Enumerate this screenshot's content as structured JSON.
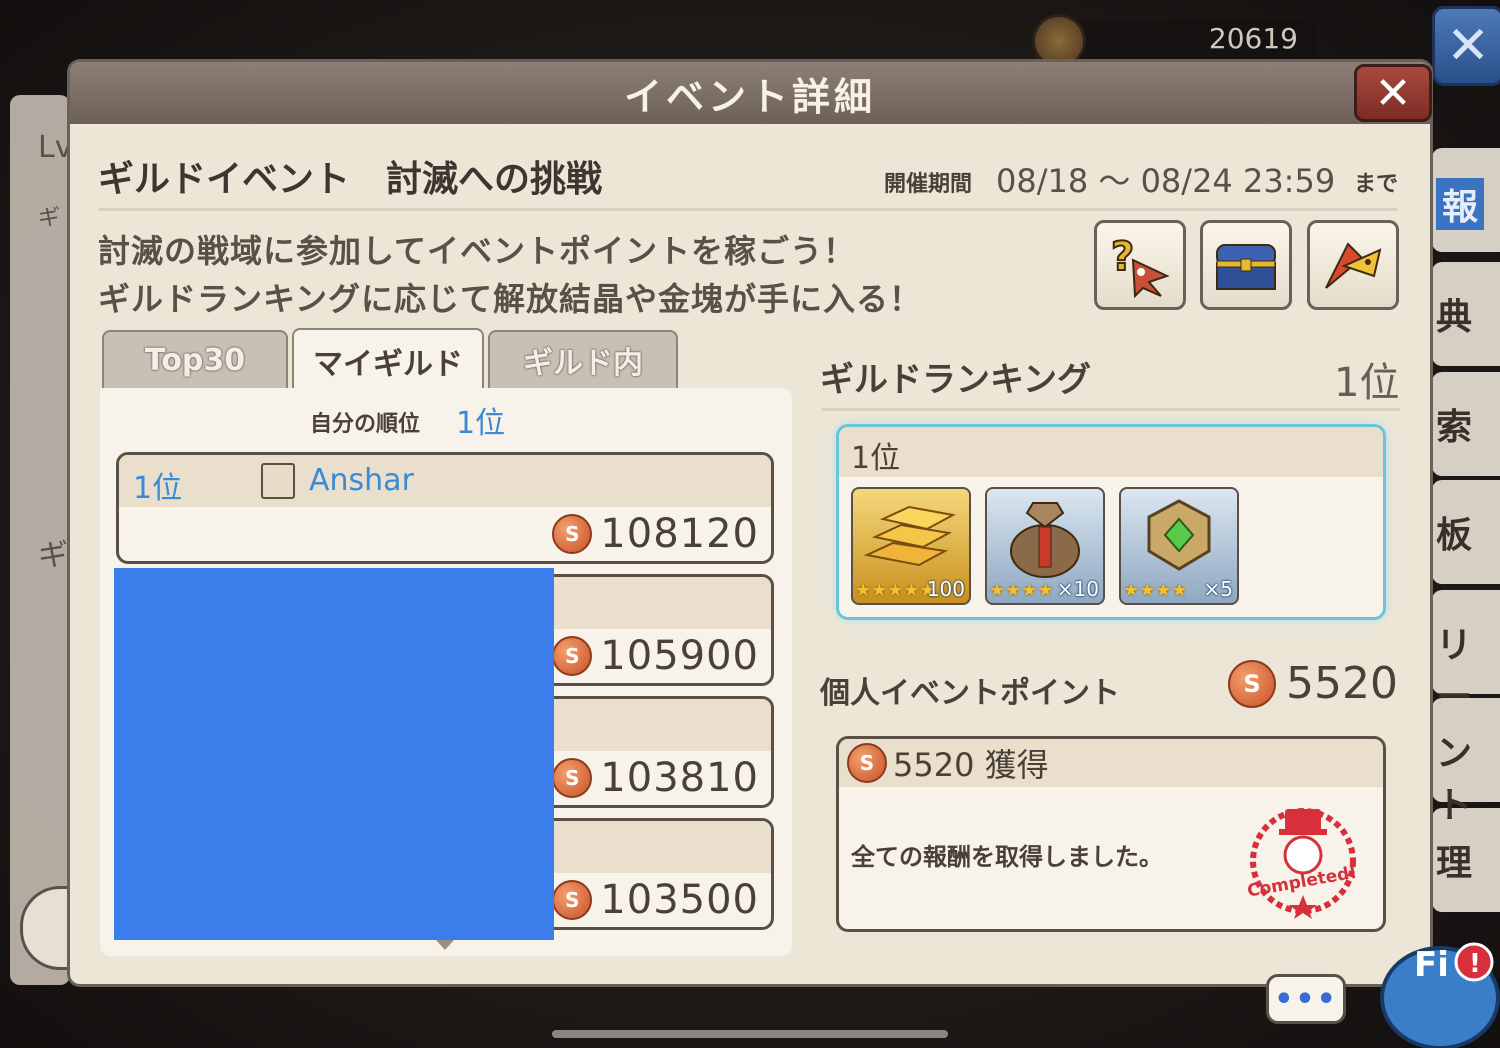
{
  "top_bar": {
    "currency_value": "20619"
  },
  "background": {
    "left_labels": [
      "Lv",
      "ギ",
      "ギ"
    ],
    "right_tabs": [
      "報",
      "典",
      "索",
      "板",
      "リー",
      "ント",
      "理"
    ]
  },
  "dialog": {
    "title": "イベント詳細",
    "event_name": "ギルドイベント　討滅への挑戦",
    "period_label": "開催期間",
    "period_value": "08/18 ～ 08/24 23:59",
    "period_suffix": "まで",
    "description": [
      "討滅の戦域に参加してイベントポイントを稼ごう！",
      "ギルドランキングに応じて解放結晶や金塊が手に入る！"
    ],
    "icon_buttons": [
      "help-icon",
      "treasure-chest-icon",
      "flag-icon"
    ]
  },
  "tabs": [
    {
      "label": "Top30",
      "active": false
    },
    {
      "label": "マイギルド",
      "active": true
    },
    {
      "label": "ギルド内",
      "active": false
    }
  ],
  "my_guild": {
    "my_rank_label": "自分の順位",
    "my_rank_value": "1位",
    "rows": [
      {
        "rank": "1位",
        "guild_name": "Anshar",
        "points": "108120"
      },
      {
        "rank": "",
        "guild_name": "",
        "points": "105900"
      },
      {
        "rank": "",
        "guild_name": "",
        "points": "103810"
      },
      {
        "rank": "",
        "guild_name": "",
        "points": "103500"
      }
    ]
  },
  "guild_ranking": {
    "title": "ギルドランキング",
    "value": "1位",
    "reward_rank": "1位",
    "rewards": [
      {
        "name": "gold-bars-icon",
        "stars": "★★★★★",
        "qty": "100"
      },
      {
        "name": "item-bag-icon",
        "stars": "★★★★",
        "qty": "×10"
      },
      {
        "name": "crystal-emblem-icon",
        "stars": "★★★★",
        "qty": "×5"
      }
    ]
  },
  "personal": {
    "title": "個人イベントポイント",
    "value": "5520",
    "obtained_label": "5520 獲得",
    "message": "全ての報酬を取得しました。",
    "stamp_text": "Completed!"
  },
  "chat": {
    "dots": "•••"
  },
  "mascot": {
    "text": "Fi"
  },
  "colors": {
    "accent_blue": "#3a8ad6",
    "redacted": "#3b7dea",
    "reward_border": "#6dc4d8"
  }
}
